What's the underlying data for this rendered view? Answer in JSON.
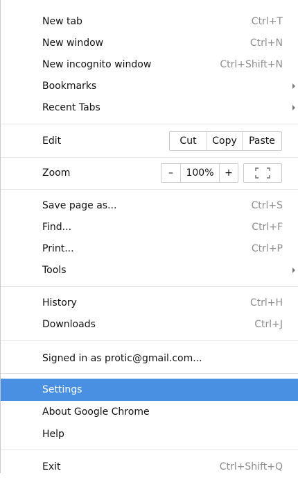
{
  "menu": {
    "new_tab": {
      "label": "New tab",
      "shortcut": "Ctrl+T"
    },
    "new_window": {
      "label": "New window",
      "shortcut": "Ctrl+N"
    },
    "new_incognito": {
      "label": "New incognito window",
      "shortcut": "Ctrl+Shift+N"
    },
    "bookmarks": {
      "label": "Bookmarks"
    },
    "recent_tabs": {
      "label": "Recent Tabs"
    },
    "edit": {
      "label": "Edit",
      "cut": "Cut",
      "copy": "Copy",
      "paste": "Paste"
    },
    "zoom": {
      "label": "Zoom",
      "minus": "–",
      "level": "100%",
      "plus": "+"
    },
    "save_page": {
      "label": "Save page as...",
      "shortcut": "Ctrl+S"
    },
    "find": {
      "label": "Find...",
      "shortcut": "Ctrl+F"
    },
    "print": {
      "label": "Print...",
      "shortcut": "Ctrl+P"
    },
    "tools": {
      "label": "Tools"
    },
    "history": {
      "label": "History",
      "shortcut": "Ctrl+H"
    },
    "downloads": {
      "label": "Downloads",
      "shortcut": "Ctrl+J"
    },
    "signed_in": {
      "label": "Signed in as protic@gmail.com..."
    },
    "settings": {
      "label": "Settings"
    },
    "about": {
      "label": "About Google Chrome"
    },
    "help": {
      "label": "Help"
    },
    "exit": {
      "label": "Exit",
      "shortcut": "Ctrl+Shift+Q"
    }
  },
  "colors": {
    "highlight": "#4a90e2",
    "shortcut_text": "#8c8c8c",
    "separator": "#e3e3e3"
  },
  "icons": {
    "submenu": "submenu-arrow-icon",
    "fullscreen": "fullscreen-icon"
  }
}
